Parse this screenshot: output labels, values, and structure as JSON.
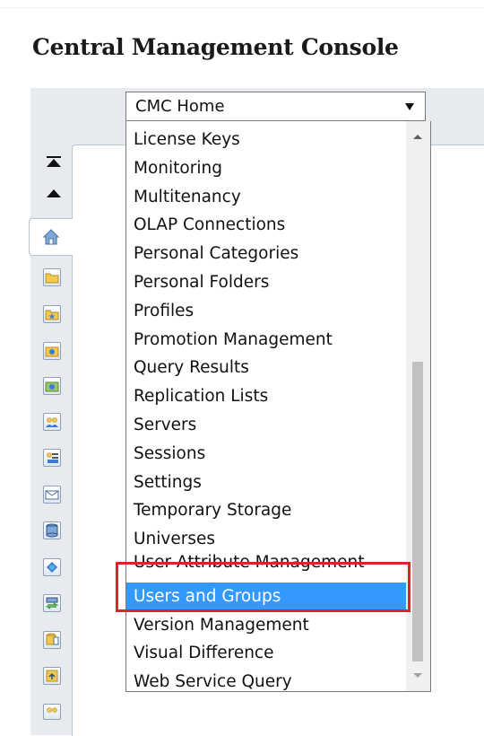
{
  "header": {
    "title": "Central Management Console"
  },
  "nav_select": {
    "value": "CMC Home",
    "options": [
      "License Keys",
      "Monitoring",
      "Multitenancy",
      "OLAP Connections",
      "Personal Categories",
      "Personal Folders",
      "Profiles",
      "Promotion Management",
      "Query Results",
      "Replication Lists",
      "Servers",
      "Sessions",
      "Settings",
      "Temporary Storage",
      "Universes",
      "User Attribute Management",
      "Users and Groups",
      "Version Management",
      "Visual Difference",
      "Web Service Query"
    ],
    "selected": "Users and Groups"
  },
  "sidebar": {
    "icons": [
      "home-icon",
      "folders-icon",
      "categories-icon",
      "inbox-icon",
      "personal-folders-icon",
      "users-groups-icon",
      "servers-icon",
      "events-icon",
      "connections-icon",
      "universes-icon",
      "federation-icon",
      "replication-icon",
      "applications-icon",
      "promotion-icon",
      "access-levels-icon"
    ]
  },
  "colors": {
    "selected_bg": "#3399ff",
    "highlight_border": "#e0202a",
    "panel_bg": "#e7eaef"
  }
}
